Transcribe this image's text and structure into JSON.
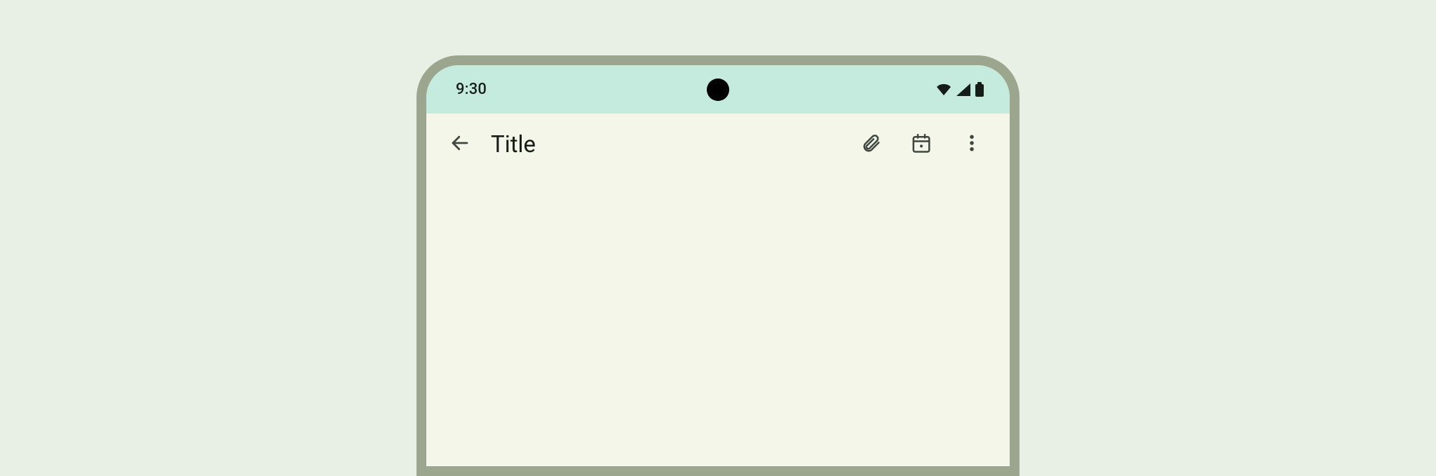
{
  "statusBar": {
    "time": "9:30"
  },
  "appBar": {
    "title": "Title"
  },
  "icons": {
    "back": "arrow-back-icon",
    "attach": "attach-icon",
    "calendar": "calendar-icon",
    "overflow": "more-vert-icon",
    "wifi": "wifi-icon",
    "signal": "cellular-signal-icon",
    "battery": "battery-full-icon",
    "camera": "camera-punch"
  },
  "colors": {
    "pageBg": "#e8efe5",
    "frame": "#9ca68e",
    "screenBg": "#f3f6e8",
    "statusBarBg": "#c5ebde",
    "onSurface": "#191d17",
    "iconColor": "#3f463f"
  }
}
